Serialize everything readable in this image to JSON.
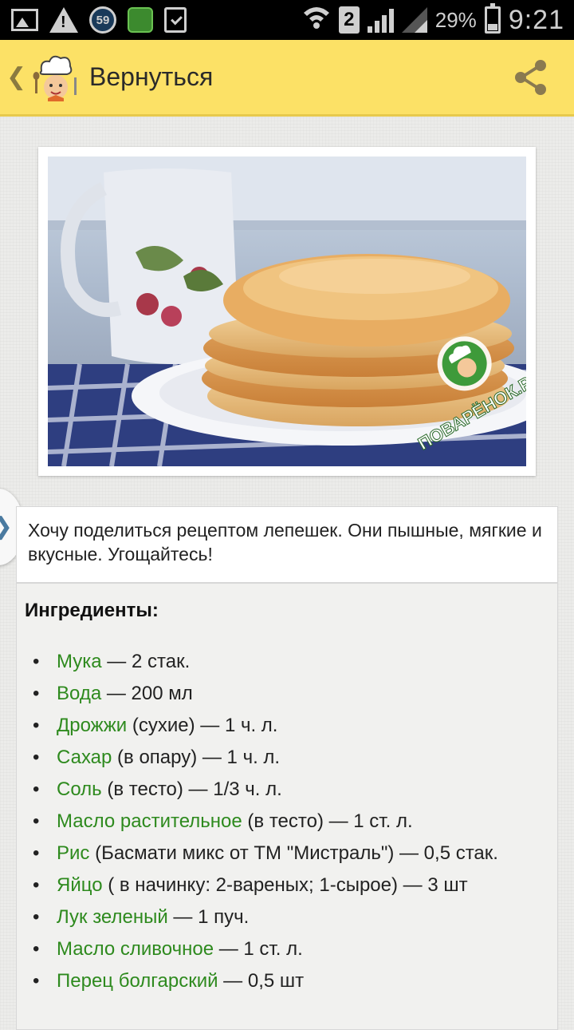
{
  "status_bar": {
    "notification_badge": "59",
    "sim_slot": "2",
    "battery_percent": "29%",
    "time": "9:21",
    "icons": [
      "image-icon",
      "warning-icon",
      "badge-icon",
      "app-icon",
      "clipboard-icon",
      "wifi-icon",
      "sim-icon",
      "signal-icon",
      "signal-icon",
      "battery-icon"
    ]
  },
  "app_bar": {
    "title": "Вернуться",
    "background_color": "#fce166",
    "icons": [
      "chevron-left-icon",
      "chef-logo-icon",
      "share-icon"
    ]
  },
  "photo": {
    "watermark": "ПОВАРЁНОК.РУ"
  },
  "intro": {
    "text": "Хочу поделиться рецептом лепешек. Они пышные, мягкие и вкусные. Угощайтесь!"
  },
  "ingredients": {
    "title": "Ингредиенты:",
    "link_color": "#2e8a1e",
    "items": [
      {
        "name": "Мука",
        "detail": " — 2 стак."
      },
      {
        "name": "Вода",
        "detail": " — 200 мл"
      },
      {
        "name": "Дрожжи",
        "detail": " (сухие) — 1 ч. л."
      },
      {
        "name": "Сахар",
        "detail": " (в опару) — 1 ч. л."
      },
      {
        "name": "Соль",
        "detail": " (в тесто) — 1/3 ч. л."
      },
      {
        "name": "Масло растительное",
        "detail": " (в тесто) — 1 ст. л."
      },
      {
        "name": "Рис",
        "detail": " (Басмати микс от ТМ \"Мистраль\") — 0,5 стак."
      },
      {
        "name": "Яйцо",
        "detail": " ( в начинку: 2-вареных; 1-сырое) — 3 шт"
      },
      {
        "name": "Лук зеленый",
        "detail": " — 1 пуч."
      },
      {
        "name": "Масло сливочное",
        "detail": " — 1 ст. л."
      },
      {
        "name": "Перец болгарский",
        "detail": " — 0,5 шт"
      }
    ]
  }
}
